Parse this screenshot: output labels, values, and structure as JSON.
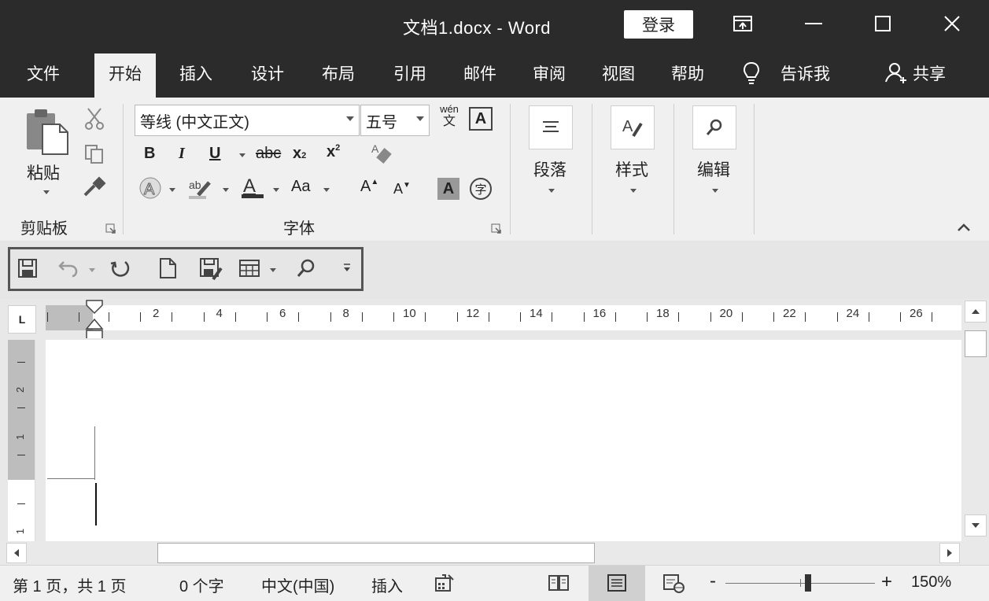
{
  "window": {
    "title": "文档1.docx  -  Word",
    "login_label": "登录"
  },
  "tabs": [
    {
      "label": "文件"
    },
    {
      "label": "开始",
      "active": true
    },
    {
      "label": "插入"
    },
    {
      "label": "设计"
    },
    {
      "label": "布局"
    },
    {
      "label": "引用"
    },
    {
      "label": "邮件"
    },
    {
      "label": "审阅"
    },
    {
      "label": "视图"
    },
    {
      "label": "帮助"
    }
  ],
  "tell_me": "告诉我",
  "share": "共享",
  "ribbon": {
    "clipboard": {
      "paste_label": "粘贴",
      "group_label": "剪贴板"
    },
    "font": {
      "font_name": "等线 (中文正文)",
      "font_size": "五号",
      "phonetic_top": "wén",
      "phonetic_bottom": "文",
      "border_char": "A",
      "bold": "B",
      "italic": "I",
      "underline": "U",
      "strike": "abc",
      "subscript": "x",
      "superscript": "x",
      "case": "Aa",
      "grow": "A",
      "shrink": "A",
      "shade_char": "A",
      "enclose_char": "字",
      "group_label": "字体"
    },
    "paragraph_label": "段落",
    "styles_label": "样式",
    "editing_label": "编辑"
  },
  "ruler": {
    "corner": "L",
    "ticks": [
      "2",
      "4",
      "6",
      "8",
      "10",
      "12",
      "14",
      "16",
      "18",
      "20",
      "22",
      "24",
      "26"
    ],
    "vticks": [
      "2",
      "1",
      "1"
    ]
  },
  "status": {
    "page": "第 1 页，共 1 页",
    "words": "0 个字",
    "language": "中文(中国)",
    "mode": "插入",
    "zoom_minus": "-",
    "zoom_plus": "+",
    "zoom": "150%",
    "zoom_fraction": 0.55
  },
  "colors": {
    "titlebar": "#2b2b2b",
    "ribbon": "#f0f0f0",
    "qat_border": "#555555"
  }
}
